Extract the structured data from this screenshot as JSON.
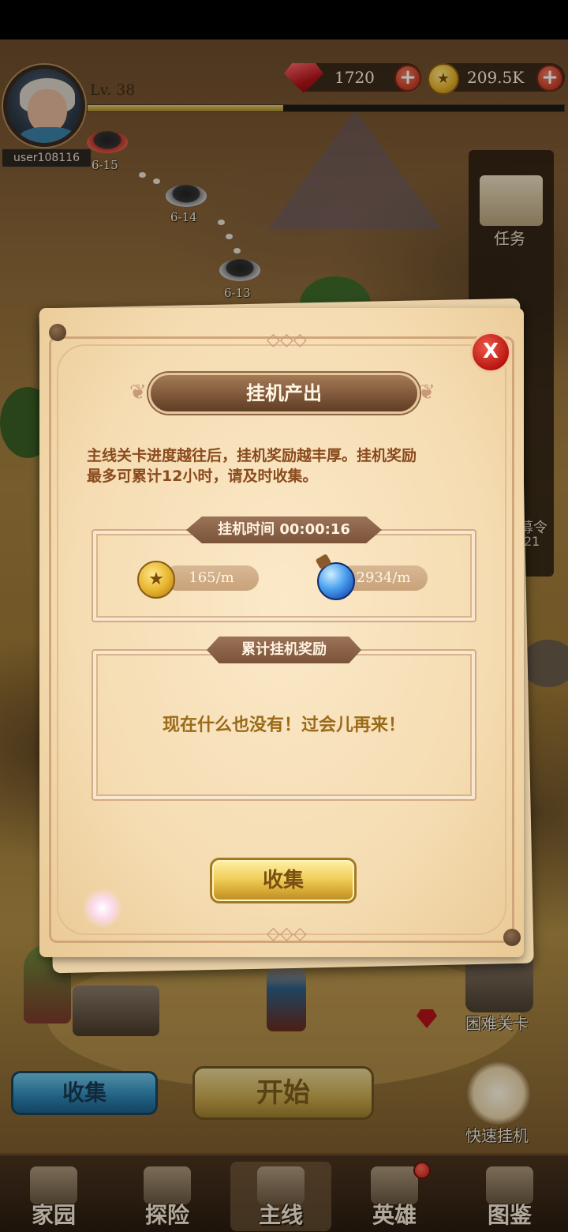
{
  "player": {
    "username": "user108116",
    "level": "Lv. 38",
    "xp_progress": 0.41
  },
  "resources": {
    "gems": "1720",
    "gold": "209.5K"
  },
  "map": {
    "stages": [
      {
        "label": "6-15"
      },
      {
        "label": "6-14"
      },
      {
        "label": "6-13"
      }
    ]
  },
  "side_menu": {
    "quest_label": "任务",
    "recruit_label": "募令",
    "recruit_count": "21"
  },
  "world_buttons": {
    "collect_label": "收集",
    "start_label": "开始",
    "hard_stage_label": "困难关卡",
    "quick_idle_label": "快速挂机"
  },
  "bottom_nav": [
    {
      "label": "家园",
      "active": false
    },
    {
      "label": "探险",
      "active": false
    },
    {
      "label": "主线",
      "active": true
    },
    {
      "label": "英雄",
      "active": false,
      "badge": true
    },
    {
      "label": "图鉴",
      "active": false
    }
  ],
  "dialog": {
    "title": "挂机产出",
    "close_label": "X",
    "description_line1": "主线关卡进度越往后，挂机奖励越丰厚。挂机奖励",
    "description_line2": "最多可累计12小时，请及时收集。",
    "idle_time_label": "挂机时间 00:00:16",
    "gold_rate": "165/m",
    "exp_rate": "2934/m",
    "rewards_label": "累计挂机奖励",
    "empty_message": "现在什么也没有！过会儿再来！",
    "collect_button": "收集"
  }
}
